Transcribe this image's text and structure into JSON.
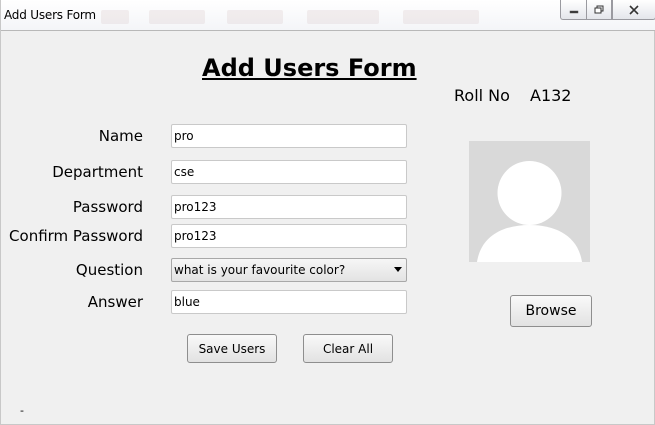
{
  "window": {
    "title": "Add Users Form",
    "controls": {
      "minimize_icon": "minimize-icon",
      "maximize_icon": "restore-icon",
      "close_icon": "close-icon"
    }
  },
  "form": {
    "heading": "Add Users Form",
    "roll_no_label": "Roll No",
    "roll_no_value": "A132",
    "fields": {
      "name": {
        "label": "Name",
        "value": "pro"
      },
      "department": {
        "label": "Department",
        "value": "cse"
      },
      "password": {
        "label": "Password",
        "value": "pro123"
      },
      "confirm_password": {
        "label": "Confirm Password",
        "value": "pro123"
      },
      "question": {
        "label": "Question",
        "selected": "what is your favourite color?"
      },
      "answer": {
        "label": "Answer",
        "value": "blue"
      }
    },
    "buttons": {
      "save": "Save Users",
      "clear": "Clear All",
      "browse": "Browse"
    },
    "photo_icon": "user-avatar-placeholder",
    "status_text": "-"
  },
  "colors": {
    "window_bg": "#f0f0f0",
    "photo_bg": "#d9d9d9",
    "avatar_fill": "#ffffff"
  }
}
